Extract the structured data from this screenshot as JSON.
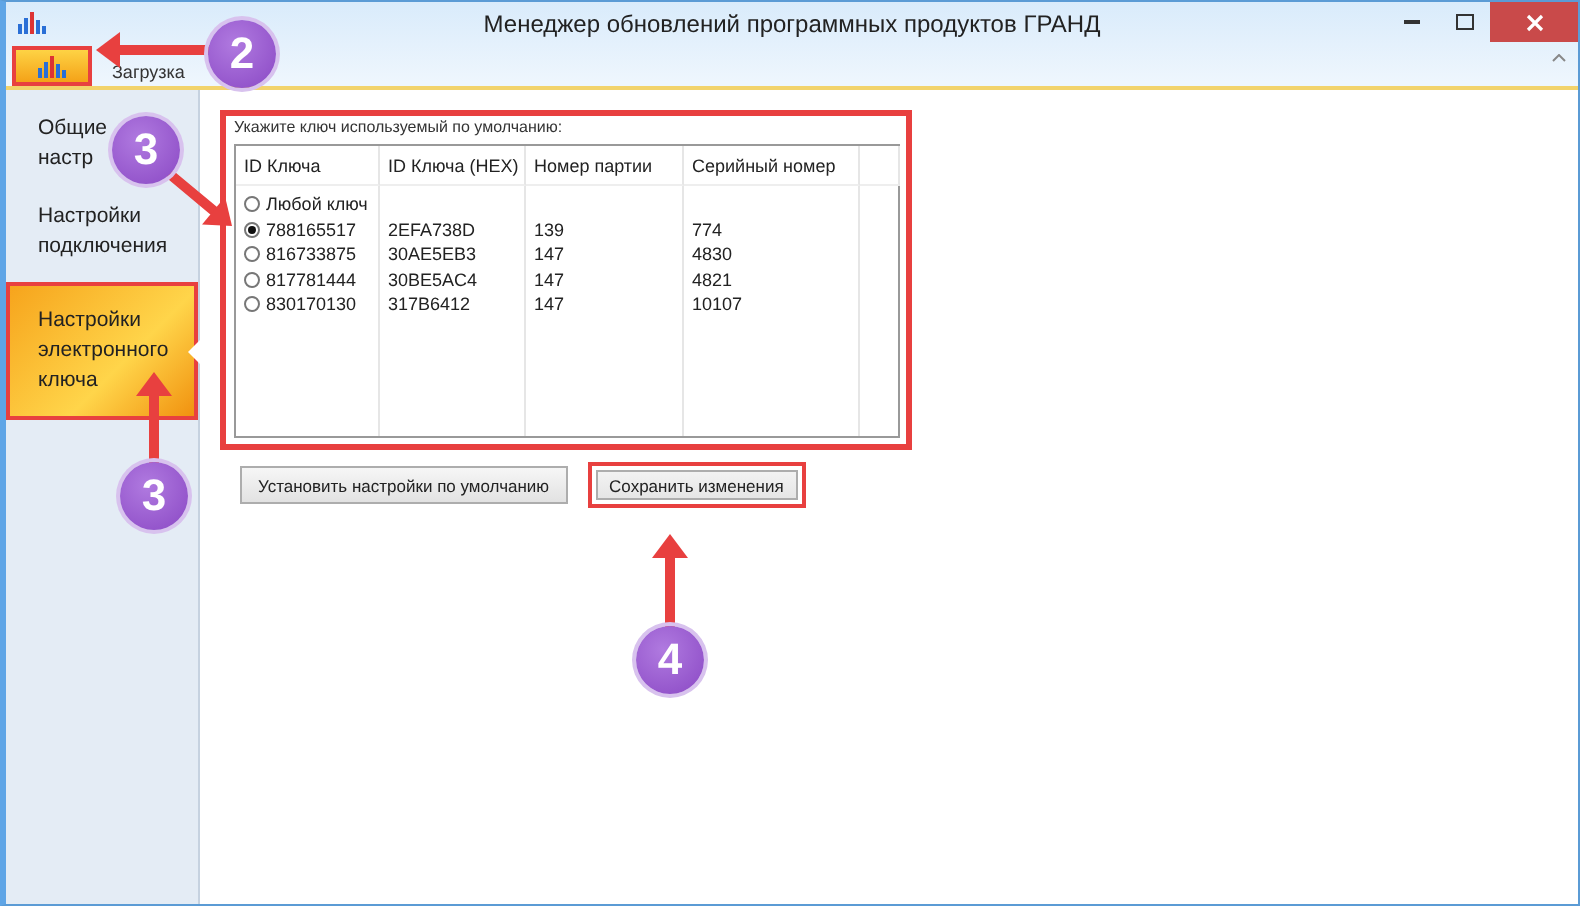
{
  "window": {
    "title": "Менеджер обновлений программных продуктов ГРАНД"
  },
  "ribbon": {
    "tabs": [
      {
        "kind": "icon",
        "selected": true,
        "highlighted": true
      },
      {
        "kind": "text",
        "label": "Загрузка",
        "selected": false,
        "highlighted": false
      }
    ]
  },
  "sidebar": {
    "items": [
      {
        "label": "Общие настр",
        "selected": false,
        "highlighted": false
      },
      {
        "label": "Настройки подключения",
        "selected": false,
        "highlighted": false
      },
      {
        "label": "Настройки электронного ключа",
        "selected": true,
        "highlighted": true
      }
    ]
  },
  "key_group": {
    "caption": "Укажите ключ используемый по умолчанию:",
    "highlighted": true,
    "table": {
      "columns": [
        "ID Ключа",
        "ID Ключа (HEX)",
        "Номер партии",
        "Серийный номер"
      ],
      "rows": [
        {
          "selected": false,
          "cells": [
            "Любой ключ"
          ]
        },
        {
          "selected": true,
          "cells": [
            "788165517",
            "2EFA738D",
            "139",
            "774"
          ]
        },
        {
          "selected": false,
          "cells": [
            "816733875",
            "30AE5EB3",
            "147",
            "4830"
          ]
        },
        {
          "selected": false,
          "cells": [
            "817781444",
            "30BE5AC4",
            "147",
            "4821"
          ]
        },
        {
          "selected": false,
          "cells": [
            "830170130",
            "317B6412",
            "147",
            "10107"
          ]
        }
      ]
    }
  },
  "buttons": [
    {
      "label": "Установить настройки по умолчанию",
      "highlighted": false
    },
    {
      "label": "Сохранить изменения",
      "highlighted": true
    }
  ],
  "annotations": [
    {
      "number": "2"
    },
    {
      "number": "3"
    },
    {
      "number": "3"
    },
    {
      "number": "4"
    }
  ]
}
